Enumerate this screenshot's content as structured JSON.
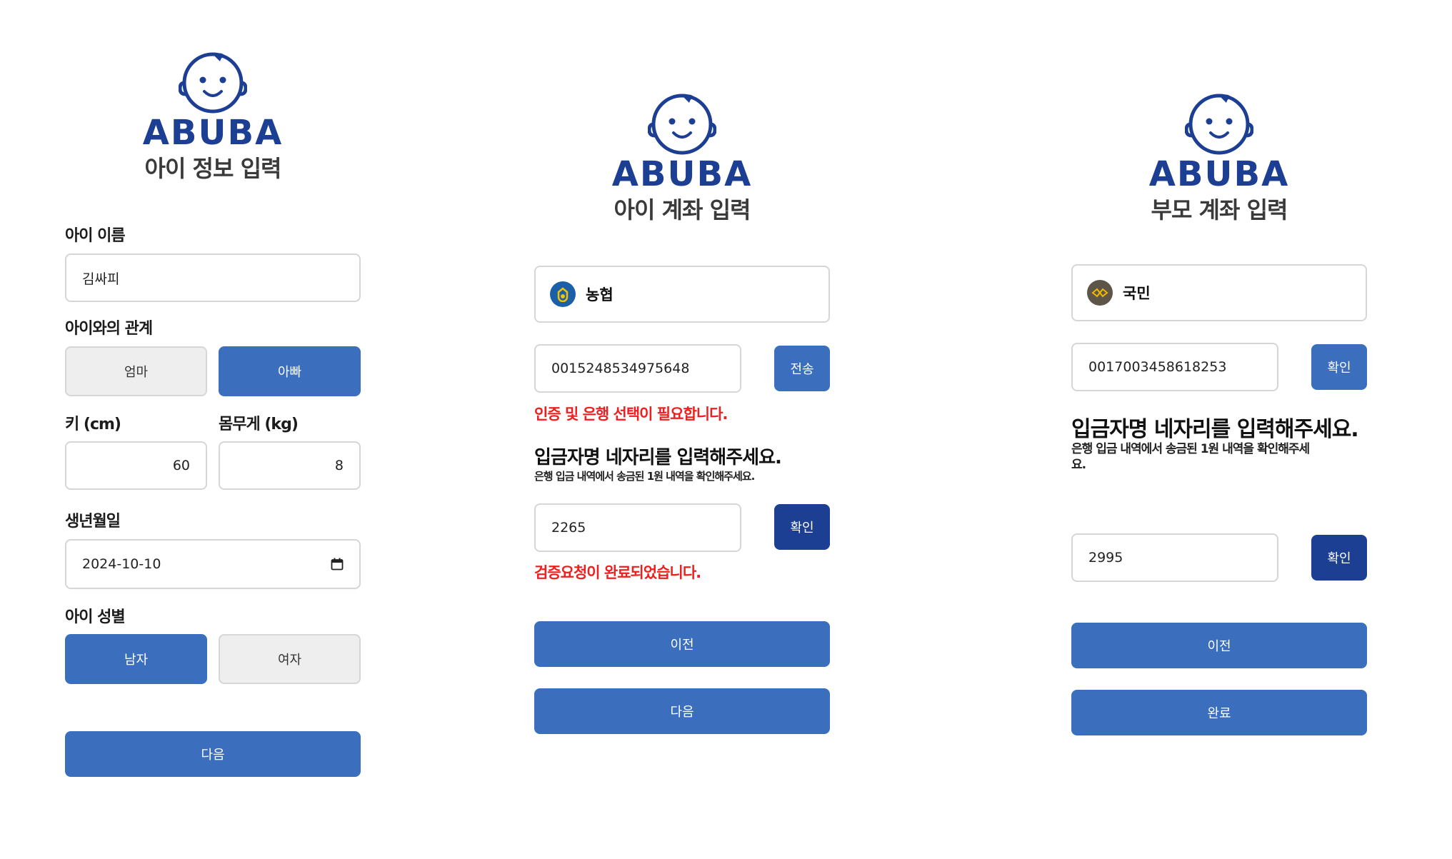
{
  "brand": {
    "name": "ABUBA"
  },
  "colors": {
    "primary": "#3b6fbd",
    "dark": "#1d3f93",
    "error": "#f01e1e",
    "brand": "#1d3f93"
  },
  "child_info": {
    "title": "아이 정보 입력",
    "name_label": "아이 이름",
    "name_value": "김싸피",
    "relation_label": "아이와의 관계",
    "relation_options": [
      "엄마",
      "아빠"
    ],
    "relation_selected": "아빠",
    "height_label": "키 (cm)",
    "height_value": "60",
    "weight_label": "몸무게 (kg)",
    "weight_value": "8",
    "birth_label": "생년월일",
    "birth_value": "2024-10-10",
    "gender_label": "아이 성별",
    "gender_options": [
      "남자",
      "여자"
    ],
    "gender_selected": "남자",
    "next_label": "다음"
  },
  "child_account": {
    "title": "아이 계좌 입력",
    "bank_name": "농협",
    "bank_icon": "nonghyup-logo-icon",
    "account_number": "0015248534975648",
    "send_label": "전송",
    "error_bank": "인증 및 은행 선택이 필요합니다.",
    "instruction_title": "입금자명 네자리를 입력해주세요.",
    "instruction_sub": "은행 입금 내역에서 송금된 1원 내역을 확인해주세요.",
    "code_value": "2265",
    "confirm_label": "확인",
    "verify_message": "검증요청이 완료되었습니다.",
    "prev_label": "이전",
    "next_label": "다음"
  },
  "parent_account": {
    "title": "부모 계좌 입력",
    "bank_name": "국민",
    "bank_icon": "kookmin-logo-icon",
    "account_number": "0017003458618253",
    "confirm_account_label": "확인",
    "instruction_title": "입금자명 네자리를 입력해주세요.",
    "instruction_sub_line1": "은행 입금 내역에서 송금된 1원 내역을 확인해주세",
    "instruction_sub_line2": "요.",
    "code_value": "2995",
    "confirm_label": "확인",
    "prev_label": "이전",
    "done_label": "완료"
  }
}
